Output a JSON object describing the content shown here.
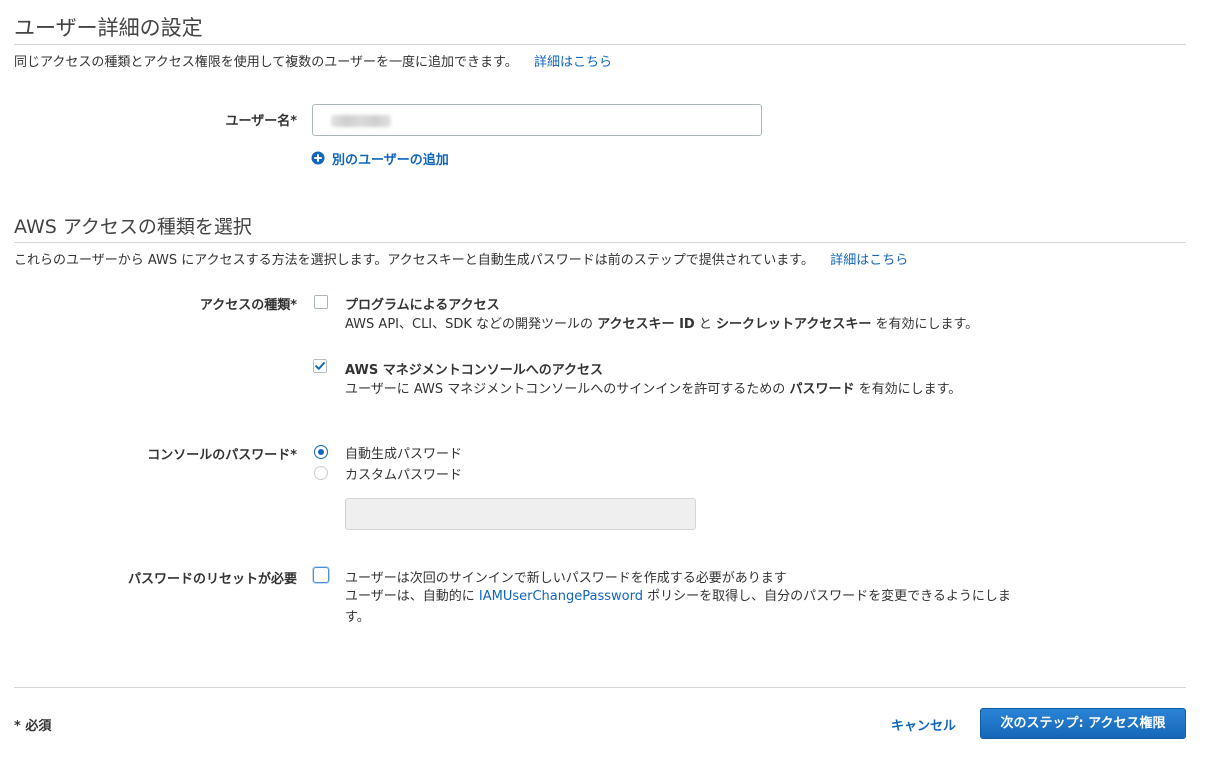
{
  "user_details": {
    "title": "ユーザー詳細の設定",
    "description": "同じアクセスの種類とアクセス権限を使用して複数のユーザーを一度に追加できます。",
    "learn_more": "詳細はこちら",
    "username_label": "ユーザー名*",
    "add_user_link": "別のユーザーの追加"
  },
  "access_type": {
    "title": "AWS アクセスの種類を選択",
    "description": "これらのユーザーから AWS にアクセスする方法を選択します。アクセスキーと自動生成パスワードは前のステップで提供されています。",
    "learn_more": "詳細はこちら",
    "label": "アクセスの種類*",
    "programmatic": {
      "checked": false,
      "title": "プログラムによるアクセス",
      "desc_1": "AWS API、CLI、SDK などの開発ツールの ",
      "desc_bold_1": "アクセスキー ID",
      "desc_2": " と ",
      "desc_bold_2": "シークレットアクセスキー",
      "desc_3": " を有効にします。"
    },
    "console": {
      "checked": true,
      "title": "AWS マネジメントコンソールへのアクセス",
      "desc_1": "ユーザーに AWS マネジメントコンソールへのサインインを許可するための ",
      "desc_bold": "パスワード",
      "desc_2": " を有効にします。"
    }
  },
  "console_password": {
    "label": "コンソールのパスワード*",
    "options": [
      {
        "label": "自動生成パスワード",
        "selected": true
      },
      {
        "label": "カスタムパスワード",
        "selected": false
      }
    ]
  },
  "password_reset": {
    "label": "パスワードのリセットが必要",
    "checked": false,
    "text": "ユーザーは次回のサインインで新しいパスワードを作成する必要があります",
    "desc_1": "ユーザーは、自動的に ",
    "policy_link": "IAMUserChangePassword",
    "desc_2": " ポリシーを取得し、自分のパスワードを変更できるようにします。"
  },
  "footer": {
    "required_note": "* 必須",
    "cancel": "キャンセル",
    "next": "次のステップ: アクセス権限"
  },
  "colors": {
    "link": "#1166bb",
    "primary_button": "#1a73c8",
    "check_blue": "#1166bb"
  }
}
